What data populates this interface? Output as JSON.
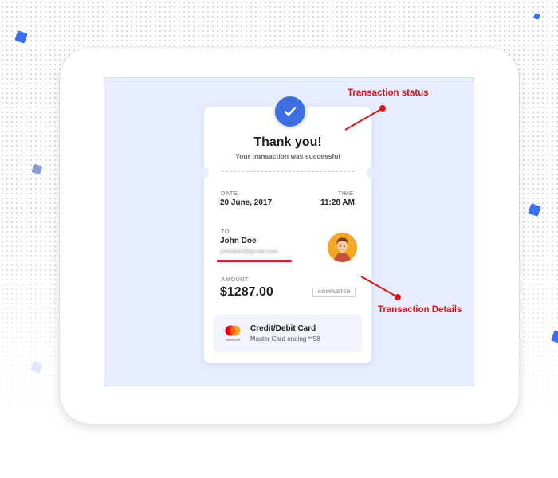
{
  "receipt": {
    "title": "Thank you!",
    "subtitle": "Your transaction was successful",
    "date_label": "DATE",
    "date_value": "20 June, 2017",
    "time_label": "TIME",
    "time_value": "11:28 AM",
    "to_label": "TO",
    "recipient_name": "John Doe",
    "recipient_email": "johndoe@gmail.com",
    "amount_label": "AMOUNT",
    "amount_value": "$1287.00",
    "status_badge": "COMPLETED",
    "payment_method_title": "Credit/Debit Card",
    "payment_method_detail": "Master Card ending **58",
    "mastercard_caption": "mastercard"
  },
  "annotations": {
    "status_label": "Transaction status",
    "details_label": "Transaction Details"
  },
  "colors": {
    "accent_blue": "#3e6fe0",
    "annotation_red": "#e01414",
    "canvas_bg": "#e7edfd",
    "avatar_bg": "#f5a623"
  },
  "icons": {
    "badge": "checkmark-icon",
    "avatar": "user-avatar-icon",
    "card_brand": "mastercard-icon"
  }
}
